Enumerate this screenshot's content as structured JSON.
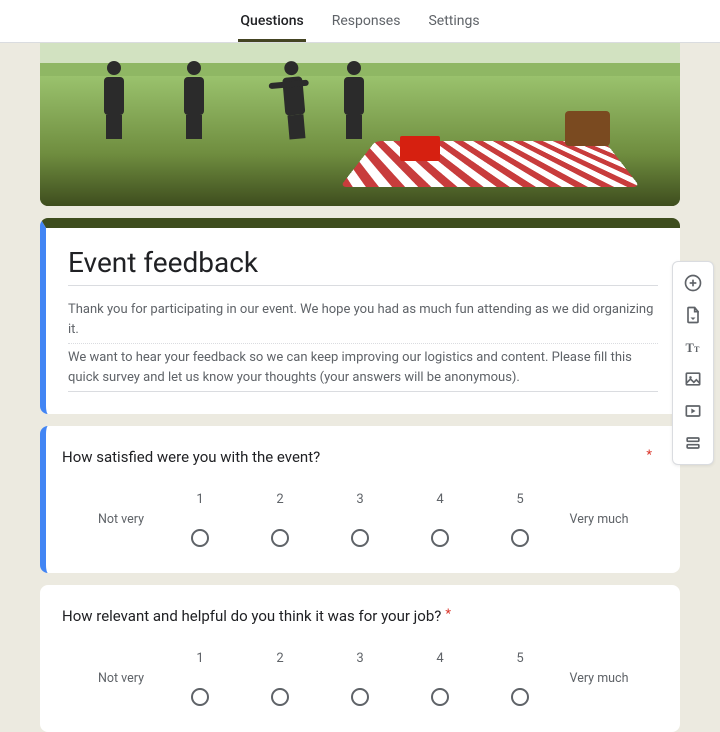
{
  "tabs": {
    "questions": "Questions",
    "responses": "Responses",
    "settings": "Settings",
    "active": "questions"
  },
  "header": {
    "title": "Event feedback",
    "desc_p1": "Thank you for participating in our event. We hope you had as much fun attending as we did organizing it.",
    "desc_p2": "We want to hear your feedback so we can keep improving our logistics and content. Please fill this quick survey and let us know your thoughts (your answers will be anonymous)."
  },
  "theme": {
    "accent": "#3e4d1e",
    "selection": "#4285f4"
  },
  "scale_labels": {
    "low": "Not very",
    "high": "Very much",
    "values": [
      "1",
      "2",
      "3",
      "4",
      "5"
    ]
  },
  "questions": [
    {
      "title": "How satisfied were you with the event?",
      "required": true,
      "selected": true
    },
    {
      "title": "How relevant and helpful do you think it was for your job?",
      "required": true,
      "selected": false
    }
  ],
  "toolbar": {
    "add_question": "Add question",
    "import_questions": "Import questions",
    "add_title": "Add title and description",
    "add_image": "Add image",
    "add_video": "Add video",
    "add_section": "Add section"
  }
}
